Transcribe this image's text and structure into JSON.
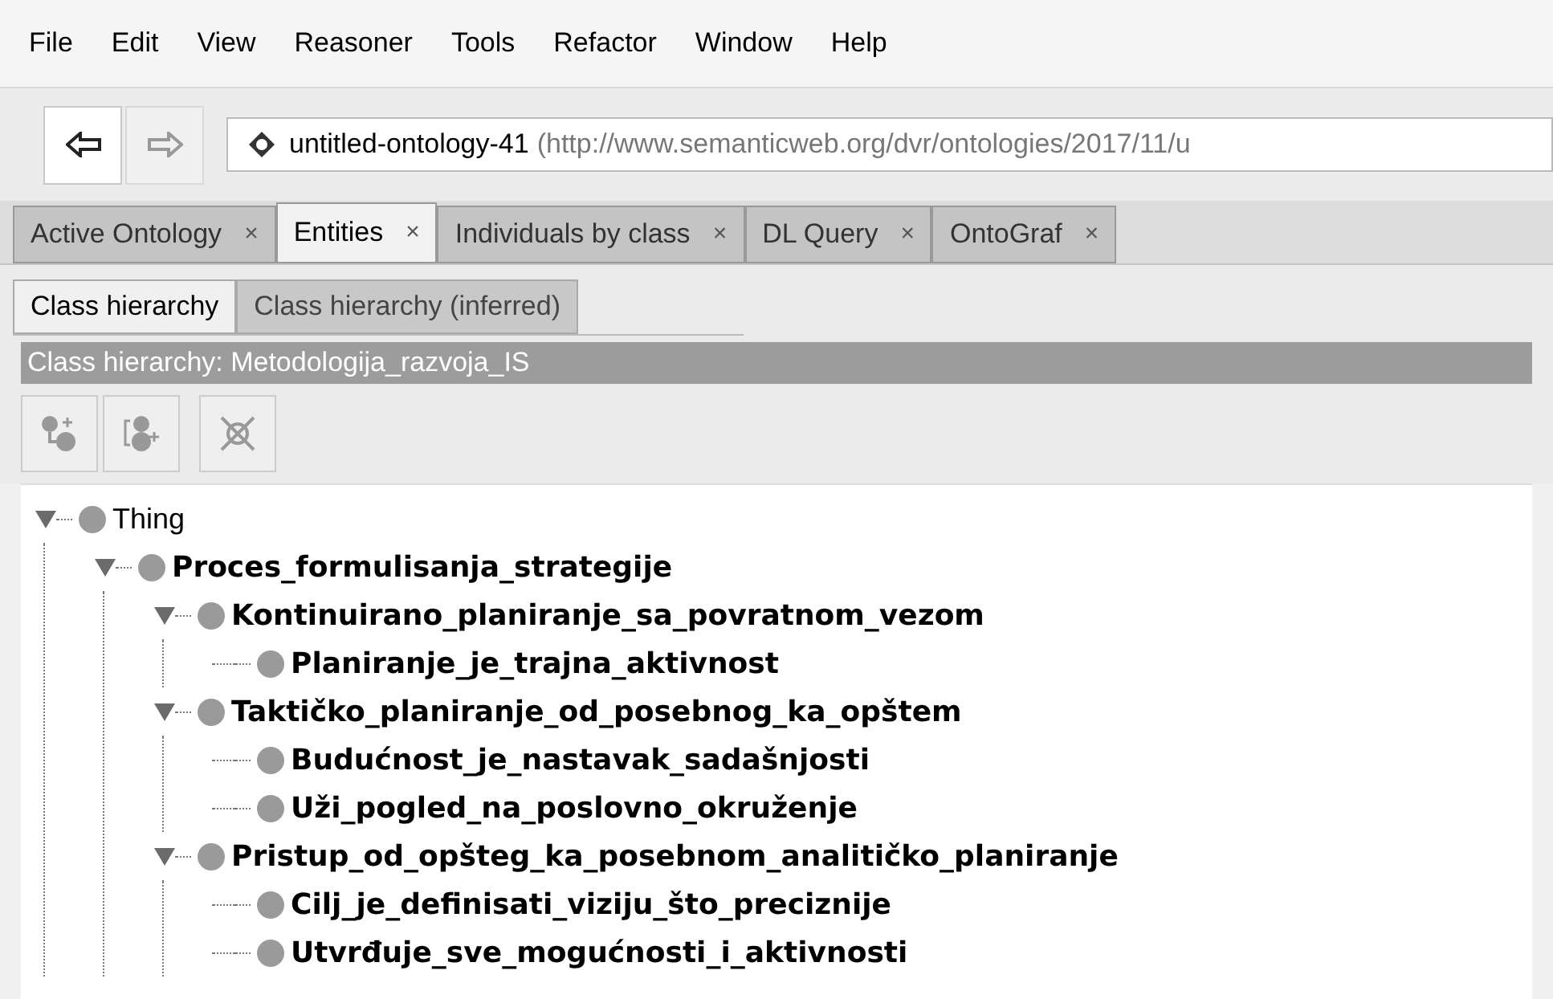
{
  "menu": [
    "File",
    "Edit",
    "View",
    "Reasoner",
    "Tools",
    "Refactor",
    "Window",
    "Help"
  ],
  "nav": {
    "back_disabled": false,
    "forward_disabled": true,
    "ontology": "untitled-ontology-41",
    "iri": "(http://www.semanticweb.org/dvr/ontologies/2017/11/u"
  },
  "tabs": [
    {
      "label": "Active Ontology",
      "close": "×",
      "selected": false
    },
    {
      "label": "Entities",
      "close": "×",
      "selected": true
    },
    {
      "label": "Individuals by class",
      "close": "×",
      "selected": false
    },
    {
      "label": "DL Query",
      "close": "×",
      "selected": false
    },
    {
      "label": "OntoGraf",
      "close": "×",
      "selected": false
    }
  ],
  "subtabs": [
    {
      "label": "Class hierarchy",
      "selected": true
    },
    {
      "label": "Class hierarchy (inferred)",
      "selected": false
    }
  ],
  "panel_title": "Class hierarchy: Metodologija_razvoja_IS",
  "tree": [
    {
      "label": "Thing",
      "bold": false,
      "expanded": true,
      "children": [
        {
          "label": "Proces_formulisanja_strategije",
          "bold": true,
          "expanded": true,
          "children": [
            {
              "label": "Kontinuirano_planiranje_sa_povratnom_vezom",
              "bold": true,
              "expanded": true,
              "children": [
                {
                  "label": "Planiranje_je_trajna_aktivnost",
                  "bold": true
                }
              ]
            },
            {
              "label": "Taktičko_planiranje_od_posebnog_ka_opštem",
              "bold": true,
              "expanded": true,
              "children": [
                {
                  "label": "Budućnost_je_nastavak_sadašnjosti",
                  "bold": true
                },
                {
                  "label": "Uži_pogled_na_poslovno_okruženje",
                  "bold": true
                }
              ]
            },
            {
              "label": "Pristup_od_opšteg_ka_posebnom_analitičko_planiranje",
              "bold": true,
              "expanded": true,
              "children": [
                {
                  "label": "Cilj_je_definisati_viziju_što_preciznije",
                  "bold": true
                },
                {
                  "label": "Utvrđuje_sve_mogućnosti_i_aktivnosti",
                  "bold": true
                }
              ]
            }
          ]
        }
      ]
    }
  ]
}
